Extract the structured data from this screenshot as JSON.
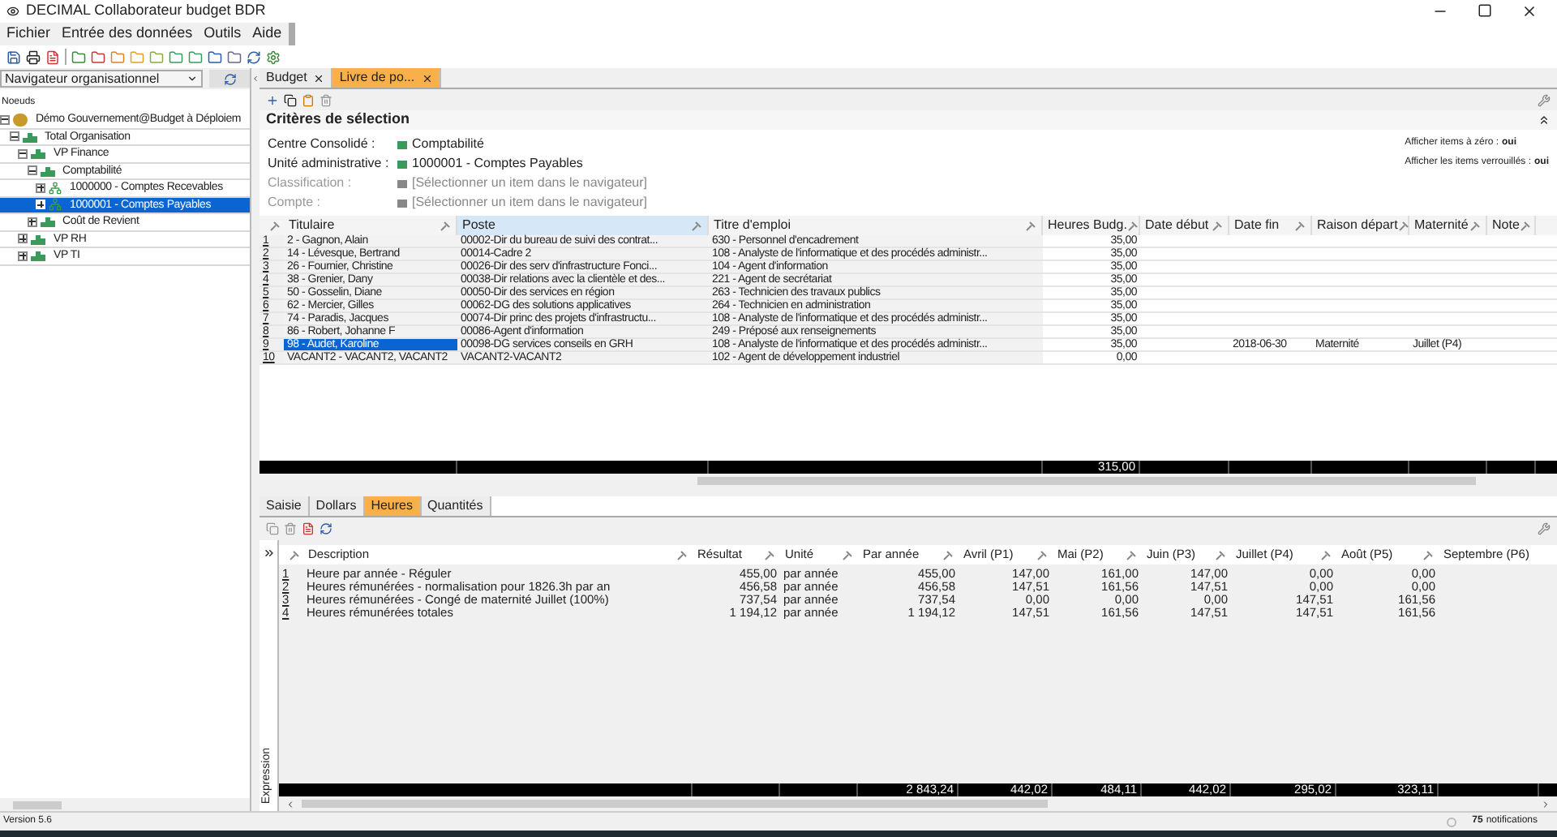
{
  "window": {
    "title": "DECIMAL Collaborateur budget BDR"
  },
  "menu": [
    "Fichier",
    "Entrée des données",
    "Outils",
    "Aide"
  ],
  "navigator": {
    "dropdown": "Navigateur organisationnel",
    "column": "Noeuds",
    "tree": [
      {
        "label": "Démo Gouvernement@Budget à Déploiem",
        "kind": "root",
        "expanded": true,
        "selected": false,
        "children": [
          {
            "label": "Total Organisation",
            "kind": "group",
            "expanded": true,
            "selected": false,
            "children": [
              {
                "label": "VP Finance",
                "kind": "group",
                "expanded": true,
                "selected": false,
                "children": [
                  {
                    "label": "Comptabilité",
                    "kind": "group",
                    "expanded": true,
                    "selected": false,
                    "children": [
                      {
                        "label": "1000000 - Comptes Recevables",
                        "kind": "unit",
                        "expanded": false,
                        "selected": false
                      },
                      {
                        "label": "1000001 - Comptes Payables",
                        "kind": "unit",
                        "expanded": false,
                        "selected": true
                      }
                    ]
                  },
                  {
                    "label": "Coût de Revient",
                    "kind": "group",
                    "expanded": false,
                    "selected": false
                  }
                ]
              },
              {
                "label": "VP RH",
                "kind": "group",
                "expanded": false,
                "selected": false
              },
              {
                "label": "VP TI",
                "kind": "group",
                "expanded": false,
                "selected": false
              }
            ]
          }
        ]
      }
    ]
  },
  "tabs": [
    {
      "label": "Budget",
      "selected": false
    },
    {
      "label": "Livre de po...",
      "selected": true
    }
  ],
  "criteria": {
    "title": "Critères de sélection",
    "fields": [
      {
        "label": "Centre Consolidé :",
        "value": "Comptabilité",
        "disabled": false
      },
      {
        "label": "Unité administrative :",
        "value": "1000001 - Comptes Payables",
        "disabled": false
      },
      {
        "label": "Classification :",
        "value": "[Sélectionner un item dans le navigateur]",
        "disabled": true
      },
      {
        "label": "Compte :",
        "value": "[Sélectionner un item dans le navigateur]",
        "disabled": true
      }
    ],
    "options": [
      {
        "label": "Afficher items à zéro :",
        "value": "oui"
      },
      {
        "label": "Afficher les items verrouillés :",
        "value": "oui"
      }
    ]
  },
  "staff_grid": {
    "columns": [
      {
        "label": "Titulaire",
        "selected": false
      },
      {
        "label": "Poste",
        "selected": true
      },
      {
        "label": "Titre d'emploi",
        "selected": false
      },
      {
        "label": "Heures Budg.",
        "selected": false
      },
      {
        "label": "Date début",
        "selected": false
      },
      {
        "label": "Date fin",
        "selected": false
      },
      {
        "label": "Raison départ",
        "selected": false
      },
      {
        "label": "Maternité",
        "selected": false
      },
      {
        "label": "Note",
        "selected": false
      }
    ],
    "rows": [
      {
        "num": "1",
        "selected": false,
        "cells": [
          "2 - Gagnon, Alain",
          "00002-Dir du bureau de suivi des contrat...",
          "630 - Personnel d'encadrement",
          "35,00"
        ]
      },
      {
        "num": "2",
        "selected": false,
        "cells": [
          "14 - Lévesque, Bertrand",
          "00014-Cadre 2",
          "108 - Analyste de l'informatique et des procédés administr...",
          "35,00"
        ]
      },
      {
        "num": "3",
        "selected": false,
        "cells": [
          "26 - Fournier, Christine",
          "00026-Dir des serv d'infrastructure Fonci...",
          "104 - Agent d'information",
          "35,00"
        ]
      },
      {
        "num": "4",
        "selected": false,
        "cells": [
          "38 - Grenier, Dany",
          "00038-Dir relations avec la clientèle et des...",
          "221 - Agent de secrétariat",
          "35,00"
        ]
      },
      {
        "num": "5",
        "selected": false,
        "cells": [
          "50 - Gosselin, Diane",
          "00050-Dir des services en région",
          "263 - Technicien des travaux publics",
          "35,00"
        ]
      },
      {
        "num": "6",
        "selected": false,
        "cells": [
          "62 - Mercier, Gilles",
          "00062-DG des solutions applicatives",
          "264 - Technicien en administration",
          "35,00"
        ]
      },
      {
        "num": "7",
        "selected": false,
        "cells": [
          "74 - Paradis, Jacques",
          "00074-Dir princ des projets d'infrastructu...",
          "108 - Analyste de l'informatique et des procédés administr...",
          "35,00"
        ]
      },
      {
        "num": "8",
        "selected": false,
        "cells": [
          "86 - Robert, Johanne F",
          "00086-Agent d'information",
          "249 - Préposé aux renseignements",
          "35,00"
        ]
      },
      {
        "num": "9",
        "selected": true,
        "cells": [
          "98 - Audet, Karoline",
          "00098-DG services conseils en GRH",
          "108 - Analyste de l'informatique et des procédés administr...",
          "35,00",
          null,
          "2018-06-30",
          "Maternité",
          "Juillet (P4)"
        ]
      },
      {
        "num": "10",
        "selected": false,
        "cells": [
          "VACANT2 - VACANT2, VACANT2",
          "VACANT2-VACANT2",
          "102 - Agent de développement industriel",
          "0,00"
        ]
      }
    ],
    "totals": [
      "315,00"
    ]
  },
  "bottom_tabs": [
    {
      "label": "Saisie",
      "selected": false
    },
    {
      "label": "Dollars",
      "selected": false
    },
    {
      "label": "Heures",
      "selected": true
    },
    {
      "label": "Quantités",
      "selected": false
    }
  ],
  "hours_grid": {
    "columns": [
      {
        "label": "Description"
      },
      {
        "label": "Résultat"
      },
      {
        "label": "Unité"
      },
      {
        "label": "Par année"
      },
      {
        "label": "Avril (P1)"
      },
      {
        "label": "Mai (P2)"
      },
      {
        "label": "Juin (P3)"
      },
      {
        "label": "Juillet (P4)"
      },
      {
        "label": "Août (P5)"
      },
      {
        "label": "Septembre (P6)"
      }
    ],
    "rows": [
      {
        "num": "1",
        "cells": [
          "Heure par année - Réguler",
          "455,00",
          "par année",
          "455,00",
          "147,00",
          "161,00",
          "147,00",
          "0,00",
          "0,00"
        ]
      },
      {
        "num": "2",
        "cells": [
          "Heures rémunérées - normalisation pour 1826.3h par an",
          "456,58",
          "par année",
          "456,58",
          "147,51",
          "161,56",
          "147,51",
          "0,00",
          "0,00"
        ]
      },
      {
        "num": "3",
        "cells": [
          "Heures rémunérées - Congé de maternité Juillet (100%)",
          "737,54",
          "par année",
          "737,54",
          "0,00",
          "0,00",
          "0,00",
          "147,51",
          "161,56"
        ]
      },
      {
        "num": "4",
        "cells": [
          "Heures rémunérées totales",
          "1 194,12",
          "par année",
          "1 194,12",
          "147,51",
          "161,56",
          "147,51",
          "147,51",
          "161,56"
        ]
      }
    ],
    "totals": [
      "2 843,24",
      "442,02",
      "484,11",
      "442,02",
      "295,02",
      "323,11"
    ],
    "side_label": "Expression"
  },
  "status_bar": {
    "version": "Version 5.6",
    "count": "75",
    "notifications": "notifications"
  }
}
